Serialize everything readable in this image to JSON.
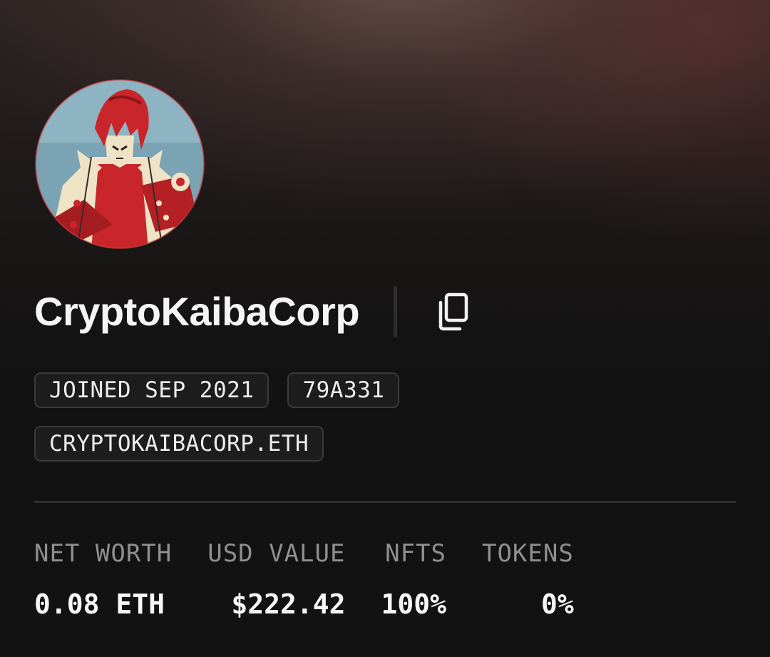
{
  "profile": {
    "username": "CryptoKaibaCorp",
    "avatar_icon": "anime-character-avatar",
    "copy_icon": "copy-icon"
  },
  "badges": {
    "joined": "JOINED SEP 2021",
    "address": "79A331",
    "ens": "CRYPTOKAIBACORP.ETH"
  },
  "stats": [
    {
      "label": "NET WORTH",
      "value": "0.08 ETH"
    },
    {
      "label": "USD VALUE",
      "value": "$222.42"
    },
    {
      "label": "NFTS",
      "value": "100%"
    },
    {
      "label": "TOKENS",
      "value": "0%"
    }
  ],
  "colors": {
    "background": "#121212",
    "badge_border": "#3b3b3b",
    "label_gray": "#8f8f8f",
    "avatar_red": "#c8262a",
    "avatar_blue": "#7aa3b4",
    "avatar_cream": "#efe3c6"
  }
}
